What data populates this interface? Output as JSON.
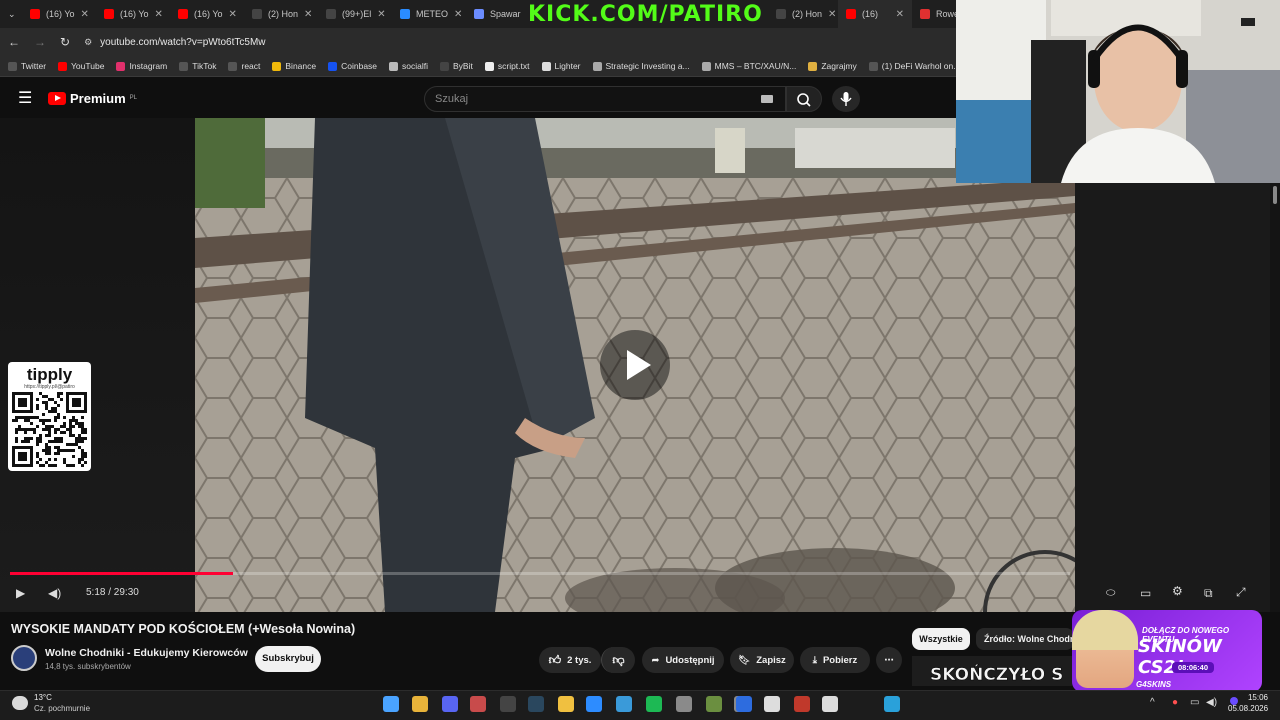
{
  "browser": {
    "tabs": [
      {
        "label": "(16) Yo",
        "icon": "youtube-icon",
        "color": "#ff0000"
      },
      {
        "label": "(16) Yo",
        "icon": "youtube-icon",
        "color": "#ff0000"
      },
      {
        "label": "(16) Yo",
        "icon": "youtube-icon",
        "color": "#ff0000"
      },
      {
        "label": "(2) Hon",
        "icon": "x-icon",
        "color": "#000000"
      },
      {
        "label": "(99+)El",
        "icon": "tiktok-icon",
        "color": "#000000"
      },
      {
        "label": "METEO",
        "icon": "globe-icon",
        "color": "#2a8cff"
      },
      {
        "label": "Spawar",
        "icon": "star-icon",
        "color": "#6b8cff"
      },
      {
        "label": "(2) Hon",
        "icon": "x-icon",
        "color": "#000000"
      },
      {
        "label": "(16)",
        "icon": "youtube-icon",
        "color": "#ff0000"
      },
      {
        "label": "Rowe",
        "icon": "bike-icon",
        "color": "#e03030"
      }
    ],
    "overlay_banner": "KICK.COM/PATIRO",
    "url": "youtube.com/watch?v=pWto6tTc5Mw",
    "bookmarks": [
      {
        "label": "Twitter",
        "icon": "x-icon",
        "color": "#000000"
      },
      {
        "label": "YouTube",
        "icon": "youtube-icon",
        "color": "#ff0000"
      },
      {
        "label": "Instagram",
        "icon": "instagram-icon",
        "color": "#e1306c"
      },
      {
        "label": "TikTok",
        "icon": "tiktok-icon",
        "color": "#000000"
      },
      {
        "label": "react",
        "icon": "tiktok-icon",
        "color": "#000000"
      },
      {
        "label": "Binance",
        "icon": "binance-icon",
        "color": "#f0b90b"
      },
      {
        "label": "Coinbase",
        "icon": "coinbase-icon",
        "color": "#1652f0"
      },
      {
        "label": "socialfi",
        "icon": "folder-icon",
        "color": "#bbbbbb"
      },
      {
        "label": "ByBit",
        "icon": "bybit-icon",
        "color": "#444444"
      },
      {
        "label": "script.txt",
        "icon": "github-icon",
        "color": "#eeeeee"
      },
      {
        "label": "Lighter",
        "icon": "lighter-icon",
        "color": "#dddddd"
      },
      {
        "label": "Strategic Investing a...",
        "icon": "loader-icon",
        "color": "#aaaaaa"
      },
      {
        "label": "MMS – BTC/XAU/N...",
        "icon": "globe-icon",
        "color": "#aaaaaa"
      },
      {
        "label": "Zagrajmy",
        "icon": "game-icon",
        "color": "#e0b040"
      },
      {
        "label": "(1) DeFi Warhol on...",
        "icon": "x-icon",
        "color": "#000000"
      }
    ]
  },
  "youtube": {
    "logo_text": "Premium",
    "logo_region": "PL",
    "search_placeholder": "Szukaj",
    "player": {
      "current_time": "5:18",
      "duration": "29:30",
      "time_display": "5:18 / 29:30",
      "progress_fraction": 0.18
    },
    "video_title": "WYSOKIE MANDATY POD KOŚCIOŁEM (+Wesoła Nowina)",
    "channel_name": "Wolne Chodniki - Edukujemy Kierowców",
    "subscribers": "14,8 tys. subskrybentów",
    "subscribe_label": "Subskrybuj",
    "likes": "2 tys.",
    "share_label": "Udostępnij",
    "save_label": "Zapisz",
    "download_label": "Pobierz",
    "chip_all": "Wszystkie",
    "chip_source": "Źródło: Wolne Chodniki",
    "recommended_thumb_text": "SKOŃCZYŁO S"
  },
  "overlays": {
    "tipply_title": "tipply",
    "tipply_url": "https://tipply.pl/@patiro",
    "ad_line1": "DOŁĄCZ DO NOWEGO EVENTU",
    "ad_line2": "SKINÓW CS2!",
    "ad_timer": "08:06:40",
    "ad_brand": "G4SKINS"
  },
  "taskbar": {
    "temperature": "13°C",
    "weather": "Cz. pochmurnie",
    "time": "15:06",
    "date": "05.08.2026"
  }
}
